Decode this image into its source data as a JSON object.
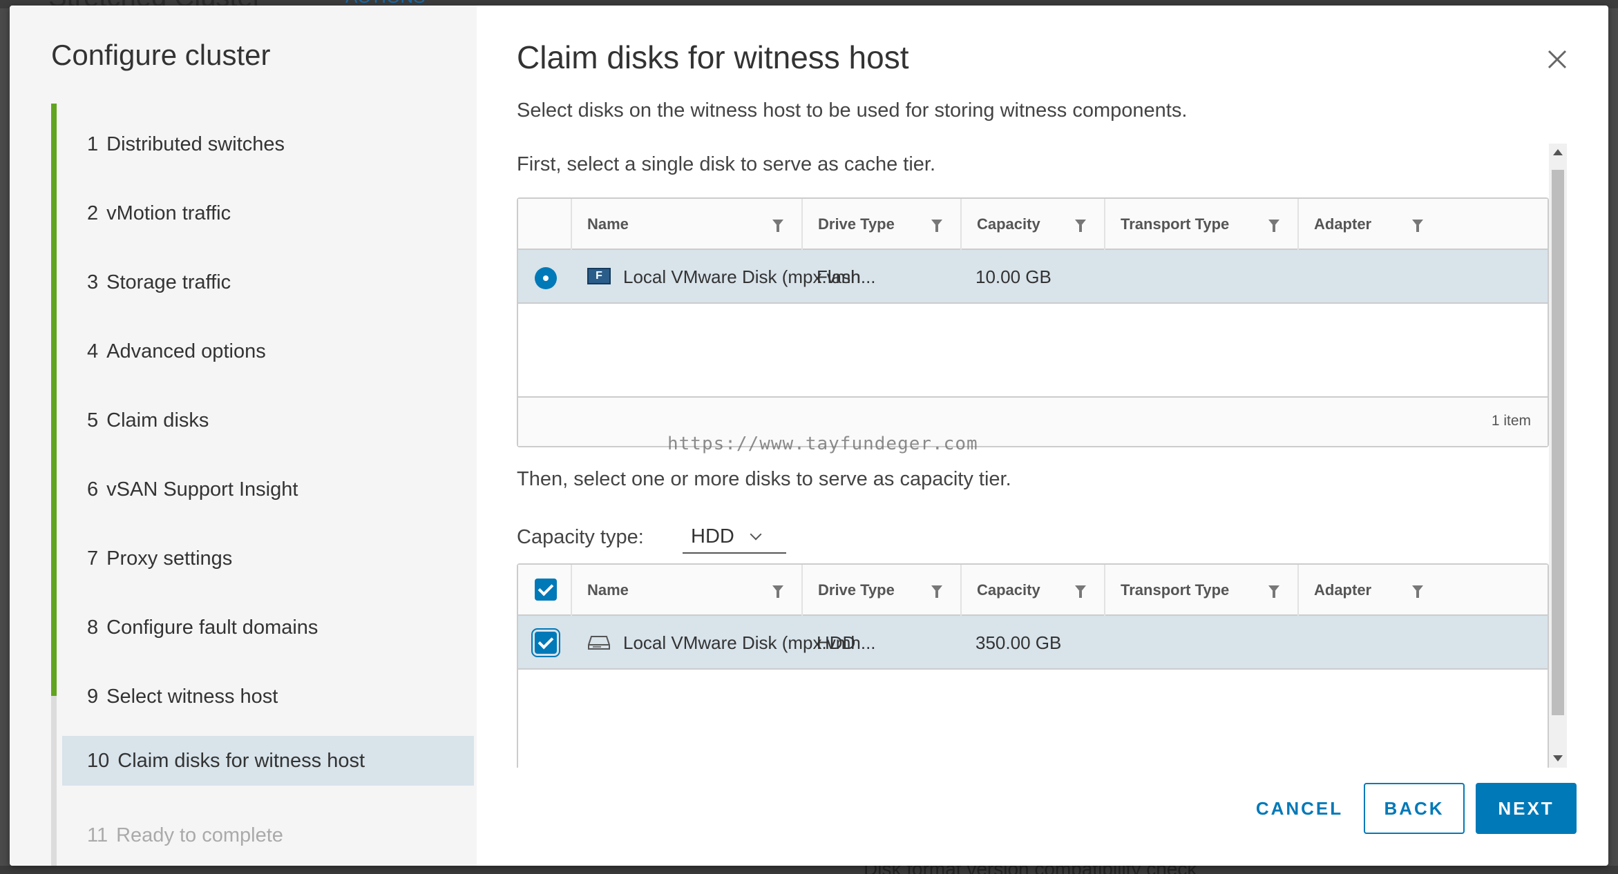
{
  "background": {
    "title": "Stretched Cluster",
    "actions": "ACTIONS",
    "bottom_text": "Disk format version compatibility check"
  },
  "nav": {
    "title": "Configure cluster",
    "steps": [
      {
        "num": "1",
        "label": "Distributed switches"
      },
      {
        "num": "2",
        "label": "vMotion traffic"
      },
      {
        "num": "3",
        "label": "Storage traffic"
      },
      {
        "num": "4",
        "label": "Advanced options"
      },
      {
        "num": "5",
        "label": "Claim disks"
      },
      {
        "num": "6",
        "label": "vSAN Support Insight"
      },
      {
        "num": "7",
        "label": "Proxy settings"
      },
      {
        "num": "8",
        "label": "Configure fault domains"
      },
      {
        "num": "9",
        "label": "Select witness host"
      },
      {
        "num": "10",
        "label": "Claim disks for witness host"
      },
      {
        "num": "11",
        "label": "Ready to complete"
      }
    ]
  },
  "main": {
    "title": "Claim disks for witness host",
    "description": "Select disks on the witness host to be used for storing witness components.",
    "cache_label": "First, select a single disk to serve as cache tier.",
    "capacity_label": "Then, select one or more disks to serve as capacity tier.",
    "capacity_type_label": "Capacity type:",
    "capacity_type_value": "HDD",
    "watermark": "https://www.tayfundeger.com",
    "columns": [
      "Name",
      "Drive Type",
      "Capacity",
      "Transport Type",
      "Adapter"
    ],
    "cache_rows": [
      {
        "name": "Local VMware Disk (mpx.vmh...",
        "drive_type": "Flash",
        "capacity": "10.00 GB",
        "transport": "",
        "adapter": ""
      }
    ],
    "cache_footer": "1 item",
    "capacity_rows": [
      {
        "name": "Local VMware Disk (mpx.vmh...",
        "drive_type": "HDD",
        "capacity": "350.00 GB",
        "transport": "",
        "adapter": ""
      }
    ],
    "flash_icon_letter": "F"
  },
  "buttons": {
    "cancel": "CANCEL",
    "back": "BACK",
    "next": "NEXT"
  },
  "colors": {
    "accent": "#0079b8",
    "progress": "#62a420",
    "selected_row": "#d8e3ea"
  }
}
